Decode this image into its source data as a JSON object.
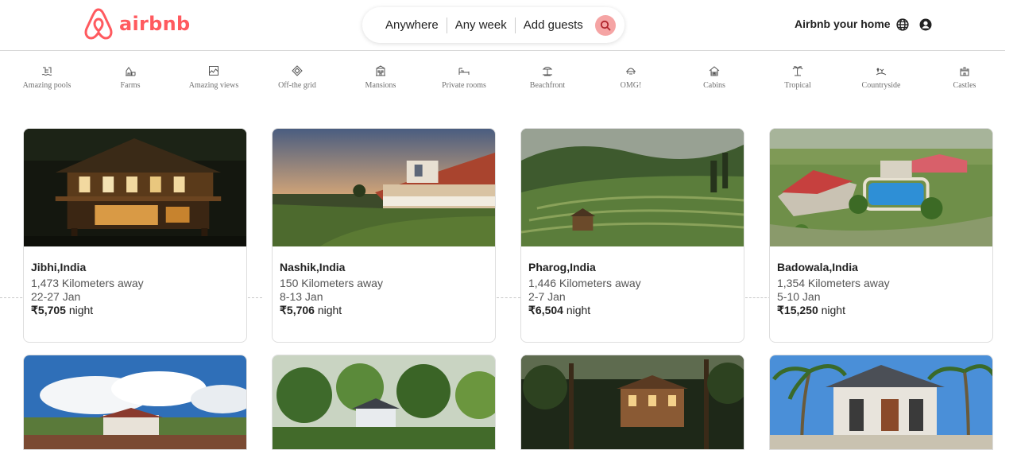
{
  "header": {
    "brand": "airbnb",
    "brand_color": "#ff5a5f",
    "search": {
      "where": "Anywhere",
      "when": "Any week",
      "who": "Add guests",
      "search_icon": "search-icon"
    },
    "host_link": "Airbnb your home",
    "globe_icon": "globe-icon",
    "profile_icon": "user-circle-icon"
  },
  "categories": [
    {
      "label": "Amazing pools",
      "icon": "pool-icon"
    },
    {
      "label": "Farms",
      "icon": "farm-icon"
    },
    {
      "label": "Amazing views",
      "icon": "view-icon"
    },
    {
      "label": "Off-the grid",
      "icon": "off-grid-icon"
    },
    {
      "label": "Mansions",
      "icon": "mansion-icon"
    },
    {
      "label": "Private rooms",
      "icon": "bed-icon"
    },
    {
      "label": "Beachfront",
      "icon": "beach-icon"
    },
    {
      "label": "OMG!",
      "icon": "omg-icon"
    },
    {
      "label": "Cabins",
      "icon": "cabin-icon"
    },
    {
      "label": "Tropical",
      "icon": "palm-icon"
    },
    {
      "label": "Countryside",
      "icon": "countryside-icon"
    },
    {
      "label": "Castles",
      "icon": "castle-icon"
    }
  ],
  "listings": [
    {
      "location": "Jibhi,India",
      "distance": "1,473 Kilometers away",
      "dates": "22-27 Jan",
      "price": "₹5,705",
      "unit": " night"
    },
    {
      "location": "Nashik,India",
      "distance": "150 Kilometers away",
      "dates": "8-13 Jan",
      "price": "₹5,706",
      "unit": " night"
    },
    {
      "location": "Pharog,India",
      "distance": "1,446 Kilometers away",
      "dates": "2-7 Jan",
      "price": "₹6,504",
      "unit": " night"
    },
    {
      "location": "Badowala,India",
      "distance": "1,354 Kilometers away",
      "dates": "5-10 Jan",
      "price": "₹15,250",
      "unit": " night"
    }
  ]
}
